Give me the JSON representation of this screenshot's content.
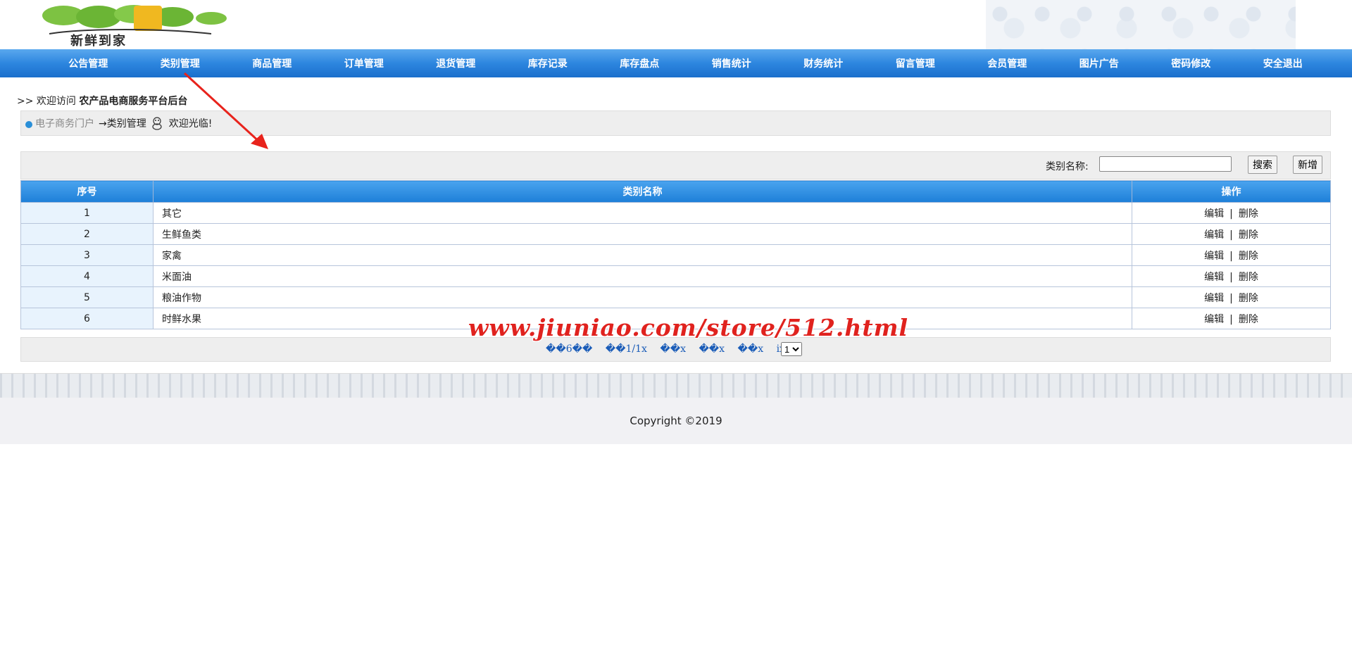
{
  "nav": {
    "items": [
      "公告管理",
      "类别管理",
      "商品管理",
      "订单管理",
      "退货管理",
      "库存记录",
      "库存盘点",
      "销售统计",
      "财务统计",
      "留言管理",
      "会员管理",
      "图片广告",
      "密码修改",
      "安全退出"
    ]
  },
  "logo": {
    "text": "新鲜到家"
  },
  "welcome": {
    "prefix": ">> 欢迎访问",
    "site": "农产品电商服务平台后台"
  },
  "breadcrumb": {
    "portal": "电子商务门户",
    "current": "→类别管理",
    "greeting": "欢迎光临!"
  },
  "search": {
    "label": "类别名称:",
    "value": "",
    "search_button": "搜索",
    "add_button": "新增"
  },
  "table": {
    "headers": [
      "序号",
      "类别名称",
      "操作"
    ],
    "rows": [
      {
        "no": "1",
        "name": "其它"
      },
      {
        "no": "2",
        "name": "生鲜鱼类"
      },
      {
        "no": "3",
        "name": "家禽"
      },
      {
        "no": "4",
        "name": "米面油"
      },
      {
        "no": "5",
        "name": "粮油作物"
      },
      {
        "no": "6",
        "name": "时鲜水果"
      }
    ],
    "edit_label": "编辑",
    "separator": "|",
    "delete_label": "删除"
  },
  "pager": {
    "links": [
      "��6��",
      "��1/1x",
      "��x",
      "��x",
      "��x",
      "ix"
    ],
    "select_value": "1"
  },
  "watermark": "www.jiuniao.com/store/512.html",
  "footer": {
    "copyright": "Copyright ©2019"
  },
  "colors": {
    "nav": "#2d86df",
    "accent_arrow": "#e8231c",
    "table_header": "#1d7fd8"
  }
}
